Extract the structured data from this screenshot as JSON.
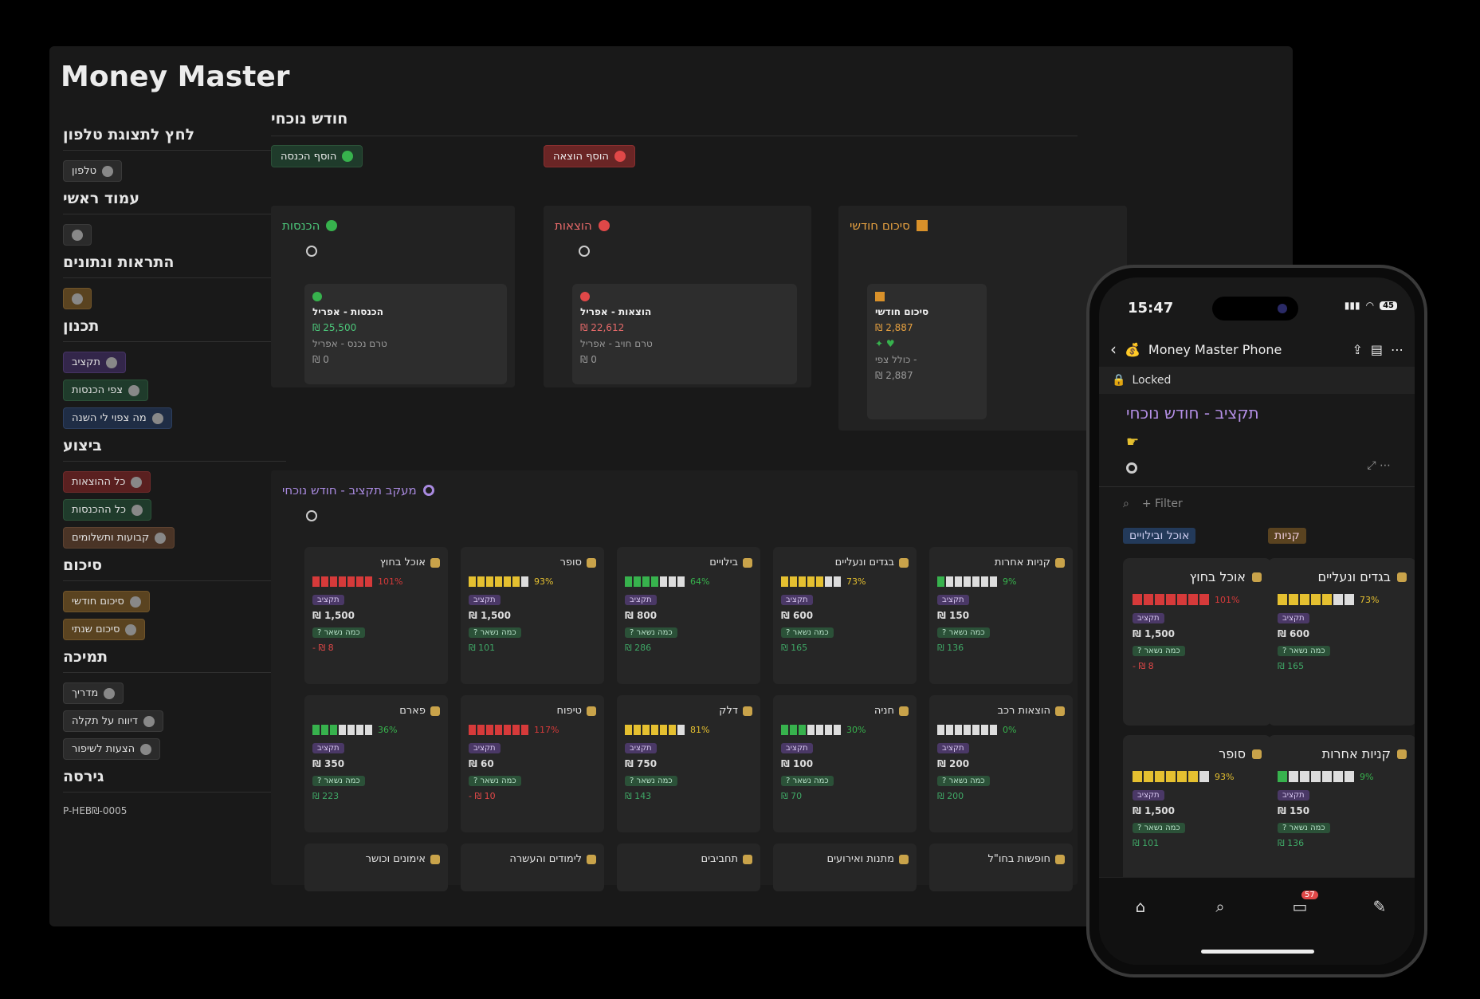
{
  "app_title": "Money Master",
  "sidebar": {
    "sections": [
      {
        "title": "לחץ לתצוגת טלפון",
        "items": [
          {
            "label": "טלפון",
            "icon": "phone-icon",
            "style": "gray"
          }
        ]
      },
      {
        "title": "עמוד ראשי",
        "items": [
          {
            "label": "",
            "icon": "home-icon",
            "style": "gray"
          }
        ]
      },
      {
        "title": "התראות ונתונים",
        "items": [
          {
            "label": "",
            "icon": "bell-icon",
            "style": "orange"
          }
        ]
      },
      {
        "title": "תכנון",
        "items": [
          {
            "label": "תקציב",
            "icon": "pie-icon",
            "style": "purple"
          },
          {
            "label": "צפי הכנסות",
            "icon": "arrow-up-circle-icon",
            "style": "green"
          },
          {
            "label": "מה צפוי לי השנה",
            "icon": "binoculars-icon",
            "style": "blue"
          }
        ]
      },
      {
        "title": "ביצוע",
        "items": [
          {
            "label": "כל ההוצאות",
            "icon": "arrow-down-circle-icon",
            "style": "red"
          },
          {
            "label": "כל ההכנסות",
            "icon": "arrow-up-circle-icon",
            "style": "green"
          },
          {
            "label": "קבועות ותשלומים",
            "icon": "clock-icon",
            "style": "brown"
          }
        ]
      },
      {
        "title": "סיכום",
        "items": [
          {
            "label": "סיכום חודשי",
            "icon": "calendar-icon",
            "style": "orange"
          },
          {
            "label": "סיכום שנתי",
            "icon": "chart-icon",
            "style": "orange"
          }
        ]
      },
      {
        "title": "תמיכה",
        "items": [
          {
            "label": "מדריך",
            "icon": "book-icon",
            "style": "gray"
          },
          {
            "label": "דיווח על תקלה",
            "icon": "tools-icon",
            "style": "gray"
          },
          {
            "label": "הצעות לשיפור",
            "icon": "pencil-icon",
            "style": "gray"
          }
        ]
      },
      {
        "title": "גירסה",
        "items": []
      }
    ],
    "version": "P-HEB₪-0005"
  },
  "main": {
    "title": "חודש נוכחי",
    "add_income": "הוסף הכנסה",
    "add_expense": "הוסף הוצאה",
    "income_panel": {
      "title": "הכנסות",
      "card_title": "הכנסות - אפריל",
      "amount": "₪ 25,500",
      "sub": "טרם נכנס - אפריל",
      "sub_amount": "₪ 0"
    },
    "expense_panel": {
      "title": "הוצאות",
      "card_title": "הוצאות - אפריל",
      "amount": "₪ 22,612",
      "sub": "טרם חויב - אפריל",
      "sub_amount": "₪ 0"
    },
    "summary_panel": {
      "title": "סיכום חודשי",
      "card_title": "סיכום חודשי",
      "amount": "₪ 2,887",
      "sub": "- כולל צפי",
      "sub_amount": "₪ 2,887"
    },
    "tracker_title": "מעקב תקציב - חודש נוכחי",
    "budget_tag": "תקציב",
    "remaining_tag": "כמה נשאר ?",
    "categories": [
      {
        "name": "אוכל בחוץ",
        "icon": "burger-icon",
        "percent": "101%",
        "filled": 7,
        "color": "#d63a3a",
        "budget": "₪ 1,500",
        "remaining": "- ₪ 8",
        "neg": true
      },
      {
        "name": "סופר",
        "icon": "cart-icon",
        "percent": "93%",
        "filled": 6,
        "color": "#e5c030",
        "budget": "₪ 1,500",
        "remaining": "₪ 101",
        "neg": false
      },
      {
        "name": "בילויים",
        "icon": "popcorn-icon",
        "percent": "64%",
        "filled": 4,
        "color": "#37b24d",
        "budget": "₪ 800",
        "remaining": "₪ 286",
        "neg": false
      },
      {
        "name": "בגדים ונעליים",
        "icon": "jeans-icon",
        "percent": "73%",
        "filled": 5,
        "color": "#e5c030",
        "budget": "₪ 600",
        "remaining": "₪ 165",
        "neg": false
      },
      {
        "name": "קניות אחרות",
        "icon": "bag-icon",
        "percent": "9%",
        "filled": 1,
        "color": "#37b24d",
        "budget": "₪ 150",
        "remaining": "₪ 136",
        "neg": false
      },
      {
        "name": "פארם",
        "icon": "bottle-icon",
        "percent": "36%",
        "filled": 3,
        "color": "#37b24d",
        "budget": "₪ 350",
        "remaining": "₪ 223",
        "neg": false
      },
      {
        "name": "טיפוח",
        "icon": "haircut-icon",
        "percent": "117%",
        "filled": 7,
        "color": "#d63a3a",
        "budget": "₪ 60",
        "remaining": "- ₪ 10",
        "neg": true
      },
      {
        "name": "דלק",
        "icon": "fuel-icon",
        "percent": "81%",
        "filled": 6,
        "color": "#e5c030",
        "budget": "₪ 750",
        "remaining": "₪ 143",
        "neg": false
      },
      {
        "name": "חניה",
        "icon": "parking-icon",
        "percent": "30%",
        "filled": 3,
        "color": "#37b24d",
        "budget": "₪ 100",
        "remaining": "₪ 70",
        "neg": false
      },
      {
        "name": "הוצאות רכב",
        "icon": "car-icon",
        "percent": "0%",
        "filled": 0,
        "color": "#37b24d",
        "budget": "₪ 200",
        "remaining": "₪ 200",
        "neg": false
      }
    ],
    "bottom_row": [
      {
        "name": "אימונים וכושר",
        "icon": "dumbbell-icon"
      },
      {
        "name": "לימודים והעשרה",
        "icon": "graduation-icon"
      },
      {
        "name": "תחביבים",
        "icon": "guitar-icon"
      },
      {
        "name": "מתנות ואירועים",
        "icon": "gift-icon"
      },
      {
        "name": "חופשות בחו\"ל",
        "icon": "plane-icon"
      }
    ]
  },
  "phone": {
    "time": "15:47",
    "battery": "45",
    "page_title": "Money Master Phone",
    "locked": "Locked",
    "heading": "תקציב - חודש נוכחי",
    "filter": "+ Filter",
    "group1": "אוכל ובילויים",
    "group2": "קניות",
    "cards": [
      {
        "name": "אוכל בחוץ",
        "percent": "101%",
        "filled": 7,
        "color": "#d63a3a",
        "budget": "₪ 1,500",
        "remaining": "- ₪ 8",
        "neg": true
      },
      {
        "name": "בגדים ונעליים",
        "percent": "73%",
        "filled": 5,
        "color": "#e5c030",
        "budget": "₪ 600",
        "remaining": "₪ 165",
        "neg": false
      },
      {
        "name": "סופר",
        "percent": "93%",
        "filled": 6,
        "color": "#e5c030",
        "budget": "₪ 1,500",
        "remaining": "₪ 101",
        "neg": false
      },
      {
        "name": "קניות אחרות",
        "percent": "9%",
        "filled": 1,
        "color": "#37b24d",
        "budget": "₪ 150",
        "remaining": "₪ 136",
        "neg": false
      }
    ],
    "badge": "57"
  }
}
